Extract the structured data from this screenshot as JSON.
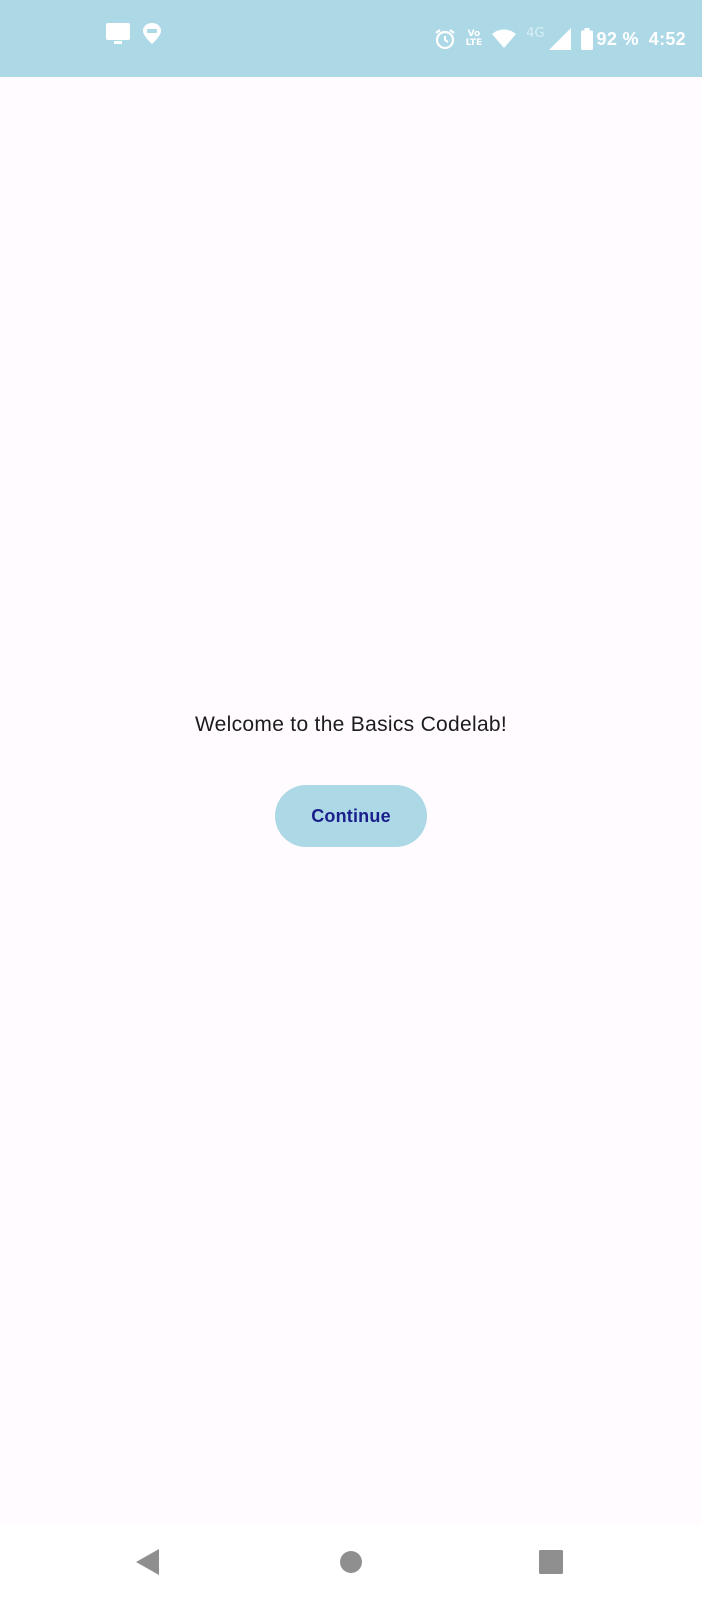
{
  "status_bar": {
    "background": "#ADD8E6",
    "left_icons": [
      "monitor-icon",
      "location-chat-icon"
    ],
    "right_icons": [
      "alarm-icon",
      "volte-icon",
      "wifi-icon",
      "network-4g-icon",
      "signal-icon",
      "battery-icon"
    ],
    "volte_line1": "Vo",
    "volte_line2": "LTE",
    "network_type": "4G",
    "battery_percent": "92 %",
    "time": "4:52"
  },
  "main": {
    "background": "#FFFBFE",
    "welcome_text": "Welcome to the Basics Codelab!",
    "continue_label": "Continue",
    "button_color": "#ADD8E6",
    "button_text_color": "#1A1F8C"
  },
  "nav_bar": {
    "buttons": [
      "back-icon",
      "home-icon",
      "recents-icon"
    ]
  }
}
